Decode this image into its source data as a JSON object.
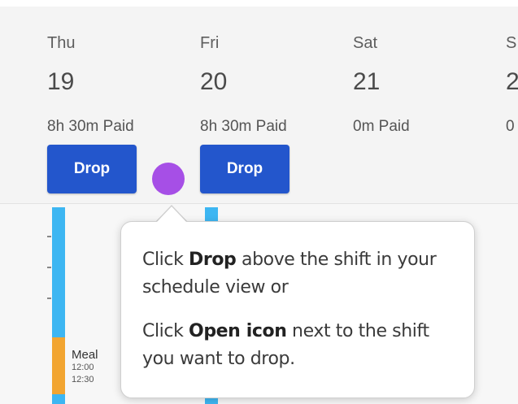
{
  "days": [
    {
      "name": "Thu",
      "date": "19",
      "paid": "8h 30m Paid",
      "drop_label": "Drop"
    },
    {
      "name": "Fri",
      "date": "20",
      "paid": "8h 30m Paid",
      "drop_label": "Drop"
    },
    {
      "name": "Sat",
      "date": "21",
      "paid": "0m Paid"
    },
    {
      "name": "S",
      "date": "2",
      "paid": "0"
    }
  ],
  "shift": {
    "meal_label": "Meal",
    "meal_start": "12:00",
    "meal_end": "12:30"
  },
  "tooltip": {
    "line1_prefix": "Click ",
    "line1_bold": "Drop",
    "line1_suffix": " above the shift in your schedule view or",
    "line2_prefix": "Click ",
    "line2_bold": "Open icon",
    "line2_suffix": " next to the shift you want to drop."
  },
  "colors": {
    "button_blue": "#2356cc",
    "shift_blue": "#3db6f2",
    "meal_orange": "#f2a531",
    "cursor_purple": "#a64fe6"
  }
}
